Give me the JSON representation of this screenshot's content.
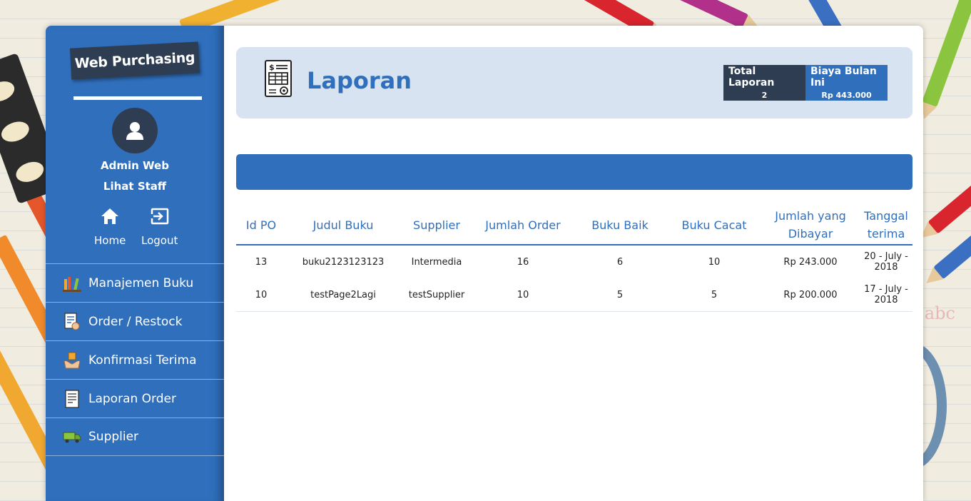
{
  "sidebar": {
    "brand": "Web Purchasing",
    "user_name": "Admin Web",
    "user_link": "Lihat Staff",
    "quick_links": [
      {
        "label": "Home",
        "icon": "home-icon"
      },
      {
        "label": "Logout",
        "icon": "logout-icon"
      }
    ],
    "menu": [
      {
        "label": "Manajemen Buku",
        "icon": "books-icon"
      },
      {
        "label": "Order / Restock",
        "icon": "order-form-icon"
      },
      {
        "label": "Konfirmasi Terima",
        "icon": "hands-package-icon"
      },
      {
        "label": "Laporan Order",
        "icon": "report-document-icon"
      },
      {
        "label": "Supplier",
        "icon": "delivery-truck-icon"
      }
    ]
  },
  "header": {
    "title": "Laporan",
    "icon": "invoice-report-icon",
    "stats": [
      {
        "title": "Total Laporan",
        "value": "2"
      },
      {
        "title": "Biaya Bulan Ini",
        "value": "Rp 443.000"
      }
    ]
  },
  "table": {
    "columns": [
      "Id PO",
      "Judul Buku",
      "Supplier",
      "Jumlah Order",
      "Buku Baik",
      "Buku Cacat",
      "Jumlah yang Dibayar",
      "Tanggal terima"
    ],
    "rows": [
      [
        "13",
        "buku2123123123",
        "Intermedia",
        "16",
        "6",
        "10",
        "Rp 243.000",
        "20 - July - 2018"
      ],
      [
        "10",
        "testPage2Lagi",
        "testSupplier",
        "10",
        "5",
        "5",
        "Rp 200.000",
        "17 - July - 2018"
      ]
    ]
  },
  "colors": {
    "primary": "#2f6fbc",
    "dark": "#2f3d52",
    "header_bg": "#d7e3f1"
  }
}
